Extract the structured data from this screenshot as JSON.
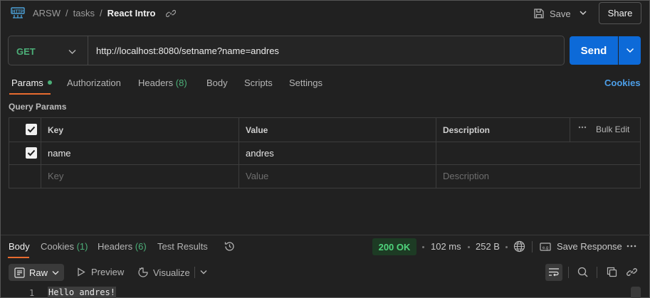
{
  "header": {
    "breadcrumb": [
      "ARSW",
      "tasks"
    ],
    "separator": "/",
    "title": "React Intro",
    "save_label": "Save",
    "share_label": "Share"
  },
  "request": {
    "method": "GET",
    "url": "http://localhost:8080/setname?name=andres",
    "send_label": "Send"
  },
  "request_tabs": [
    {
      "label": "Params"
    },
    {
      "label": "Authorization"
    },
    {
      "label": "Headers",
      "count": "(8)"
    },
    {
      "label": "Body"
    },
    {
      "label": "Scripts"
    },
    {
      "label": "Settings"
    }
  ],
  "cookies_link": "Cookies",
  "query_params": {
    "section_label": "Query Params",
    "columns": {
      "key": "Key",
      "value": "Value",
      "description": "Description"
    },
    "bulk_edit_label": "Bulk Edit",
    "rows": [
      {
        "key": "name",
        "value": "andres",
        "checked": true
      }
    ],
    "placeholders": {
      "key": "Key",
      "value": "Value",
      "description": "Description"
    }
  },
  "response": {
    "tabs": [
      {
        "label": "Body"
      },
      {
        "label": "Cookies",
        "count": "(1)"
      },
      {
        "label": "Headers",
        "count": "(6)"
      },
      {
        "label": "Test Results"
      }
    ],
    "status": "200 OK",
    "time": "102 ms",
    "size": "252 B",
    "save_response_label": "Save Response",
    "format_label": "Raw",
    "preview_label": "Preview",
    "visualize_label": "Visualize",
    "lines": [
      {
        "number": "1",
        "text": "Hello andres!"
      }
    ]
  },
  "colors": {
    "accent_orange": "#e86b2f",
    "send_blue": "#0d6ad8",
    "method_green": "#4caf78",
    "status_green": "#4fd47c",
    "link_blue": "#4d9fe8"
  },
  "icons": [
    "http-icon",
    "link-icon",
    "save-icon",
    "chevron-down-icon",
    "more-icon",
    "history-icon",
    "globe-icon",
    "save-response-icon",
    "raw-icon",
    "play-icon",
    "visualize-icon",
    "wrap-icon",
    "search-icon",
    "copy-icon",
    "link-icon"
  ]
}
